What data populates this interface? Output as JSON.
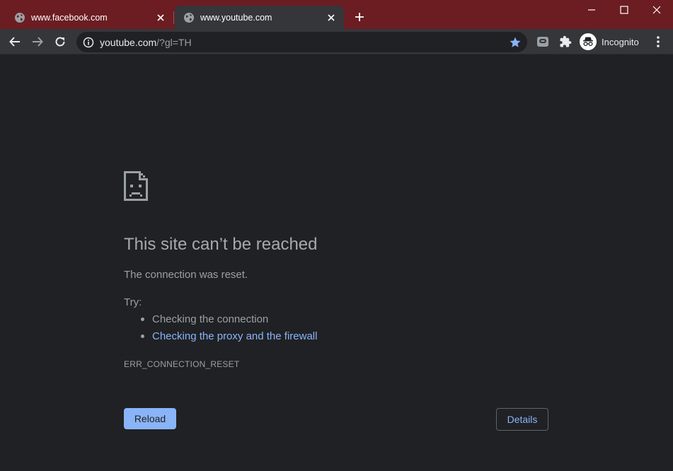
{
  "colors": {
    "tabstrip": "#6b1d22",
    "toolbar": "#35363a",
    "page_background": "#202124",
    "link": "#8ab4f8",
    "muted_text": "#9aa0a6"
  },
  "tabs": [
    {
      "title": "www.facebook.com",
      "icon": "globe-icon",
      "active": false
    },
    {
      "title": "www.youtube.com",
      "icon": "globe-icon",
      "active": true
    }
  ],
  "toolbar": {
    "url_host": "youtube.com",
    "url_path": "/?gl=TH",
    "incognito_label": "Incognito"
  },
  "error": {
    "title": "This site can’t be reached",
    "description": "The connection was reset.",
    "try_label": "Try:",
    "suggestions": [
      "Checking the connection",
      "Checking the proxy and the firewall"
    ],
    "code": "ERR_CONNECTION_RESET",
    "reload_label": "Reload",
    "details_label": "Details"
  }
}
